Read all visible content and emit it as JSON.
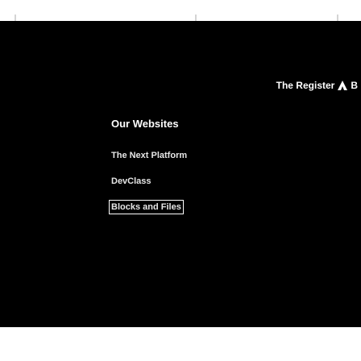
{
  "header": {
    "strapline": "The Register",
    "strapline_suffix": "B",
    "logo_icon": "register-vulture-logo-icon"
  },
  "footer_nav": {
    "heading": "Our Websites",
    "sites": [
      {
        "label": "The Next Platform"
      },
      {
        "label": "DevClass"
      },
      {
        "label": "Blocks and Files"
      }
    ]
  },
  "colors": {
    "background": "#000000",
    "text": "#ffffff",
    "link": "#e6e6e6",
    "band": "#ffffff"
  }
}
